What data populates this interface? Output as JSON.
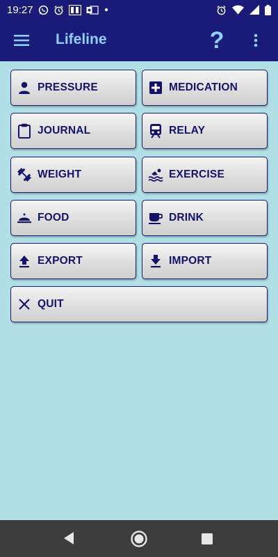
{
  "status_bar": {
    "time": "19:27",
    "left_icons": [
      "whatsapp-icon",
      "alarm-icon",
      "br-badge-icon",
      "outlook-icon",
      "dot-icon"
    ],
    "right_icons": [
      "alarm-icon",
      "wifi-icon",
      "signal-icon",
      "battery-icon"
    ]
  },
  "app_bar": {
    "title": "Lifeline",
    "help_label": "?"
  },
  "buttons": {
    "pressure": "PRESSURE",
    "medication": "MEDICATION",
    "journal": "JOURNAL",
    "relay": "RELAY",
    "weight": "WEIGHT",
    "exercise": "EXERCISE",
    "food": "FOOD",
    "drink": "DRINK",
    "export": "EXPORT",
    "import": "IMPORT",
    "quit": "QUIT"
  },
  "colors": {
    "app_bar": "#1a1a78",
    "title": "#8fd0ff",
    "background": "#b0dfe5",
    "button_text": "#13136a"
  }
}
